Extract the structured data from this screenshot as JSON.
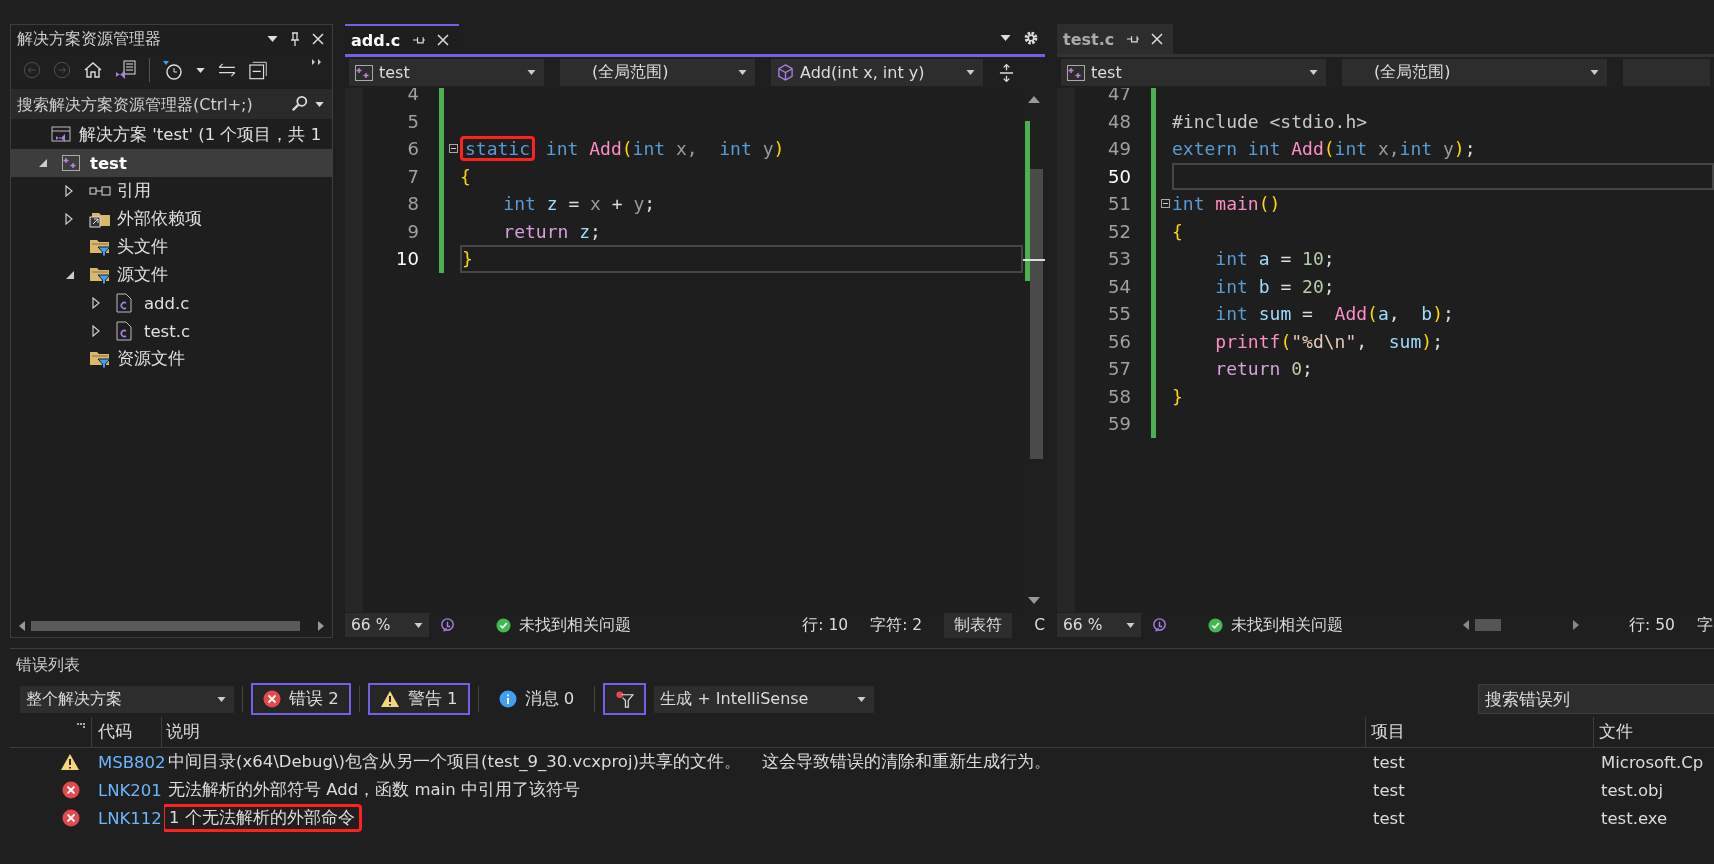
{
  "solution_explorer": {
    "title": "解决方案资源管理器",
    "search": {
      "placeholder": "搜索解决方案资源管理器(Ctrl+;)"
    },
    "tree": [
      {
        "label": "解决方案 'test' (1 个项目，共 1",
        "kind": "solution",
        "expandable": false,
        "selected": false,
        "children": [
          {
            "label": "test",
            "kind": "project",
            "expandable": true,
            "expanded": true,
            "selected": true,
            "children": [
              {
                "label": "引用",
                "kind": "references",
                "expandable": true,
                "expanded": false,
                "selected": false
              },
              {
                "label": "外部依赖项",
                "kind": "external",
                "expandable": true,
                "expanded": false,
                "selected": false
              },
              {
                "label": "头文件",
                "kind": "filter",
                "expandable": false,
                "selected": false
              },
              {
                "label": "源文件",
                "kind": "filter",
                "expandable": true,
                "expanded": true,
                "selected": false,
                "children": [
                  {
                    "label": "add.c",
                    "kind": "cfile",
                    "expandable": true,
                    "expanded": false,
                    "selected": false
                  },
                  {
                    "label": "test.c",
                    "kind": "cfile",
                    "expandable": true,
                    "expanded": false,
                    "selected": false
                  }
                ]
              },
              {
                "label": "资源文件",
                "kind": "filter",
                "expandable": false,
                "selected": false
              }
            ]
          }
        ]
      }
    ]
  },
  "editors": [
    {
      "tab": {
        "label": "add.c",
        "selected": true
      },
      "project": "test",
      "scope": "(全局范围)",
      "member": "Add(int x, int y)",
      "zoom": "66 %",
      "status": "未找到相关问题",
      "position": [
        "行: 10",
        "字符: 2",
        "制表符",
        "C"
      ],
      "lines": [
        {
          "n": "4",
          "current": false,
          "fold": false
        },
        {
          "n": "5",
          "current": false,
          "fold": false
        },
        {
          "n": "6",
          "current": false,
          "fold": true,
          "boxed": true,
          "tokens": [
            {
              "t": "static",
              "kind": "kw"
            },
            {
              "t": " int ",
              "kind": "kw"
            },
            {
              "t": "Add",
              "kind": "func"
            },
            {
              "t": "(",
              "kind": "paren"
            },
            {
              "t": "int",
              "kind": "kw"
            },
            {
              "t": " x,  ",
              "kind": "param"
            },
            {
              "t": "int",
              "kind": "kw"
            },
            {
              "t": " y",
              "kind": "param"
            },
            {
              "t": ")",
              "kind": "paren"
            }
          ]
        },
        {
          "n": "7",
          "current": false,
          "fold": false,
          "boxed": false,
          "tokens": [
            {
              "t": "{",
              "kind": "paren"
            }
          ]
        },
        {
          "n": "8",
          "current": false,
          "fold": false,
          "boxed": false,
          "tokens": [
            {
              "t": "    int",
              "kind": "kw"
            },
            {
              "t": " z",
              "kind": "local"
            },
            {
              "t": " = ",
              "kind": "plain"
            },
            {
              "t": "x",
              "kind": "param"
            },
            {
              "t": " + ",
              "kind": "plain"
            },
            {
              "t": "y",
              "kind": "param"
            },
            {
              "t": ";",
              "kind": "plain"
            }
          ]
        },
        {
          "n": "9",
          "current": false,
          "fold": false,
          "boxed": false,
          "tokens": [
            {
              "t": "    return",
              "kind": "ctrl"
            },
            {
              "t": " z",
              "kind": "local"
            },
            {
              "t": ";",
              "kind": "plain"
            }
          ]
        },
        {
          "n": "10",
          "current": true,
          "fold": false,
          "boxed": false,
          "tokens": [
            {
              "t": "}",
              "kind": "paren"
            }
          ]
        }
      ]
    },
    {
      "tab": {
        "label": "test.c",
        "selected": false
      },
      "project": "test",
      "scope": "(全局范围)",
      "zoom": "66 %",
      "status": "未找到相关问题",
      "position": [
        "行: 50",
        "字"
      ],
      "lines": [
        {
          "n": "47",
          "current": false,
          "fold": false
        },
        {
          "n": "48",
          "current": false,
          "fold": false,
          "boxed": false,
          "tokens": [
            {
              "t": "#include <stdio.h>",
              "kind": "pre"
            }
          ]
        },
        {
          "n": "49",
          "current": false,
          "fold": false,
          "boxed": false,
          "tokens": [
            {
              "t": "extern int ",
              "kind": "kw"
            },
            {
              "t": "Add",
              "kind": "func"
            },
            {
              "t": "(",
              "kind": "paren"
            },
            {
              "t": "int",
              "kind": "kw"
            },
            {
              "t": " x,",
              "kind": "param"
            },
            {
              "t": "int",
              "kind": "kw"
            },
            {
              "t": " y",
              "kind": "param"
            },
            {
              "t": ")",
              "kind": "paren"
            },
            {
              "t": ";",
              "kind": "plain"
            }
          ]
        },
        {
          "n": "50",
          "current": true,
          "fold": false
        },
        {
          "n": "51",
          "current": false,
          "fold": true,
          "boxed": false,
          "tokens": [
            {
              "t": "int ",
              "kind": "kw"
            },
            {
              "t": "main",
              "kind": "func"
            },
            {
              "t": "()",
              "kind": "paren"
            }
          ]
        },
        {
          "n": "52",
          "current": false,
          "fold": false,
          "boxed": false,
          "tokens": [
            {
              "t": "{",
              "kind": "paren"
            }
          ]
        },
        {
          "n": "53",
          "current": false,
          "fold": false,
          "boxed": false,
          "tokens": [
            {
              "t": "    int ",
              "kind": "kw"
            },
            {
              "t": "a",
              "kind": "local"
            },
            {
              "t": " = ",
              "kind": "plain"
            },
            {
              "t": "10",
              "kind": "num"
            },
            {
              "t": ";",
              "kind": "plain"
            }
          ]
        },
        {
          "n": "54",
          "current": false,
          "fold": false,
          "boxed": false,
          "tokens": [
            {
              "t": "    int ",
              "kind": "kw"
            },
            {
              "t": "b",
              "kind": "local"
            },
            {
              "t": " = ",
              "kind": "plain"
            },
            {
              "t": "20",
              "kind": "num"
            },
            {
              "t": ";",
              "kind": "plain"
            }
          ]
        },
        {
          "n": "55",
          "current": false,
          "fold": false,
          "boxed": false,
          "tokens": [
            {
              "t": "    int ",
              "kind": "kw"
            },
            {
              "t": "sum",
              "kind": "local"
            },
            {
              "t": " =  ",
              "kind": "plain"
            },
            {
              "t": "Add",
              "kind": "func"
            },
            {
              "t": "(",
              "kind": "paren"
            },
            {
              "t": "a",
              "kind": "local"
            },
            {
              "t": ",  ",
              "kind": "plain"
            },
            {
              "t": "b",
              "kind": "local"
            },
            {
              "t": ")",
              "kind": "paren"
            },
            {
              "t": ";",
              "kind": "plain"
            }
          ]
        },
        {
          "n": "56",
          "current": false,
          "fold": false,
          "boxed": false,
          "tokens": [
            {
              "t": "    printf",
              "kind": "func"
            },
            {
              "t": "(",
              "kind": "paren"
            },
            {
              "t": "\"%d\\n\"",
              "kind": "str"
            },
            {
              "t": ",  ",
              "kind": "plain"
            },
            {
              "t": "sum",
              "kind": "local"
            },
            {
              "t": ")",
              "kind": "paren"
            },
            {
              "t": ";",
              "kind": "plain"
            }
          ]
        },
        {
          "n": "57",
          "current": false,
          "fold": false,
          "boxed": false,
          "tokens": [
            {
              "t": "    return ",
              "kind": "ctrl"
            },
            {
              "t": "0",
              "kind": "num"
            },
            {
              "t": ";",
              "kind": "plain"
            }
          ]
        },
        {
          "n": "58",
          "current": false,
          "fold": false,
          "boxed": false,
          "tokens": [
            {
              "t": "}",
              "kind": "paren"
            }
          ]
        },
        {
          "n": "59",
          "current": false,
          "fold": false
        }
      ]
    }
  ],
  "error_list": {
    "title": "错误列表",
    "scope": "整个解决方案",
    "filters": [
      {
        "kind": "error",
        "label": "错误 2",
        "selected": true
      },
      {
        "kind": "warning",
        "label": "警告 1",
        "selected": true
      },
      {
        "kind": "info",
        "label": "消息 0",
        "selected": false
      },
      {
        "kind": "filter",
        "selected": true
      }
    ],
    "source": "生成 + IntelliSense",
    "search": {
      "placeholder": "搜索错误列"
    },
    "columns": [
      "代码",
      "说明",
      "项目",
      "文件"
    ],
    "rows": [
      {
        "kind": "warning",
        "code": "MSB802",
        "description": "中间目录(x64\\Debug\\)包含从另一个项目(test_9_30.vcxproj)共享的文件。    这会导致错误的清除和重新生成行为。",
        "project": "test",
        "file": "Microsoft.Cp",
        "boxed": false
      },
      {
        "kind": "error",
        "code": "LNK201",
        "description": "无法解析的外部符号 Add，函数 main 中引用了该符号",
        "project": "test",
        "file": "test.obj",
        "boxed": false
      },
      {
        "kind": "error",
        "code": "LNK112",
        "description": "1 个无法解析的外部命令",
        "project": "test",
        "file": "test.exe",
        "boxed": true
      }
    ]
  }
}
